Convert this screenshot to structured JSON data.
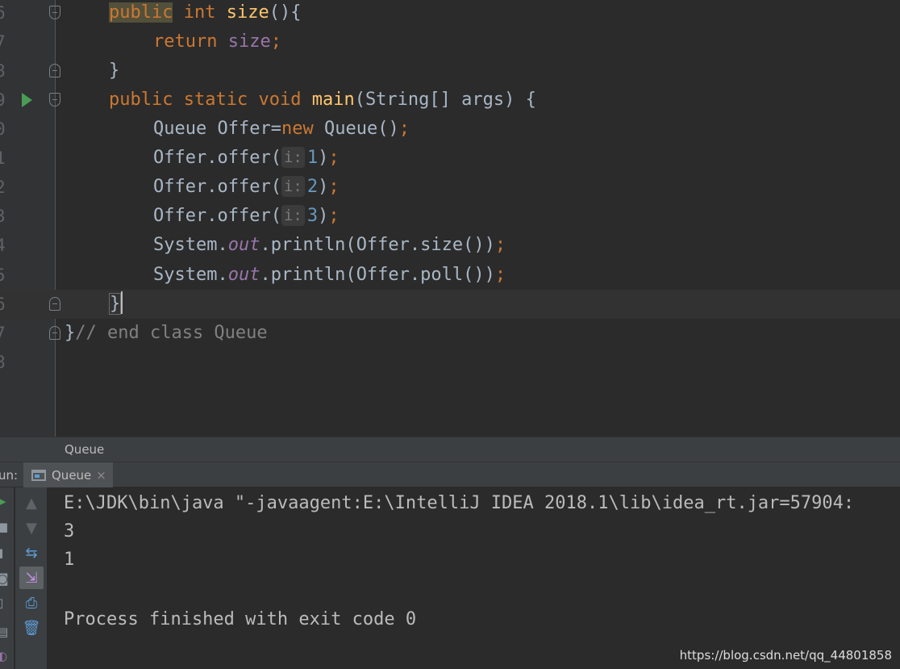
{
  "editor": {
    "line_numbers": [
      "6",
      "7",
      "8",
      "9",
      "0",
      "1",
      "2",
      "3",
      "4",
      "5",
      "6",
      "7",
      "8"
    ],
    "tokens": {
      "public": "public",
      "int": "int",
      "size": "size",
      "return": "return",
      "static": "static",
      "void": "void",
      "main": "main",
      "string_array": "String[]",
      "args": "args",
      "queue": "Queue",
      "offer_var": "Offer",
      "new": "new",
      "system": "System.",
      "out": "out",
      "println": ".println(",
      "offer_offer": "Offer.offer(",
      "offer_size": "Offer.size()",
      "offer_poll": "Offer.poll()",
      "param_hint": "i:",
      "comment": "// end class Queue"
    },
    "numbers": [
      "1",
      "2",
      "3"
    ]
  },
  "breadcrumb": {
    "text": "Queue"
  },
  "run_panel": {
    "label": "un:",
    "tab_label": "Queue",
    "tab_close": "×"
  },
  "console": {
    "lines": [
      "E:\\JDK\\bin\\java \"-javaagent:E:\\IntelliJ IDEA 2018.1\\lib\\idea_rt.jar=57904:",
      "3",
      "1",
      "",
      "Process finished with exit code 0"
    ]
  },
  "watermark": "https://blog.csdn.net/qq_44801858",
  "icons": {
    "run_gutter": "run-icon",
    "fold": "fold-icon",
    "console_tab": "console-icon",
    "toolbar": [
      "arrow-up-icon",
      "arrow-down-icon",
      "soft-wrap-icon",
      "scroll-to-end-icon",
      "print-icon",
      "trash-icon"
    ]
  },
  "colors": {
    "keyword": "#cc7832",
    "method": "#ffc66d",
    "field": "#9876aa",
    "number": "#6897bb",
    "comment": "#808080",
    "text": "#a9b7c6",
    "background": "#2b2b2b",
    "run_green": "#499c54"
  }
}
